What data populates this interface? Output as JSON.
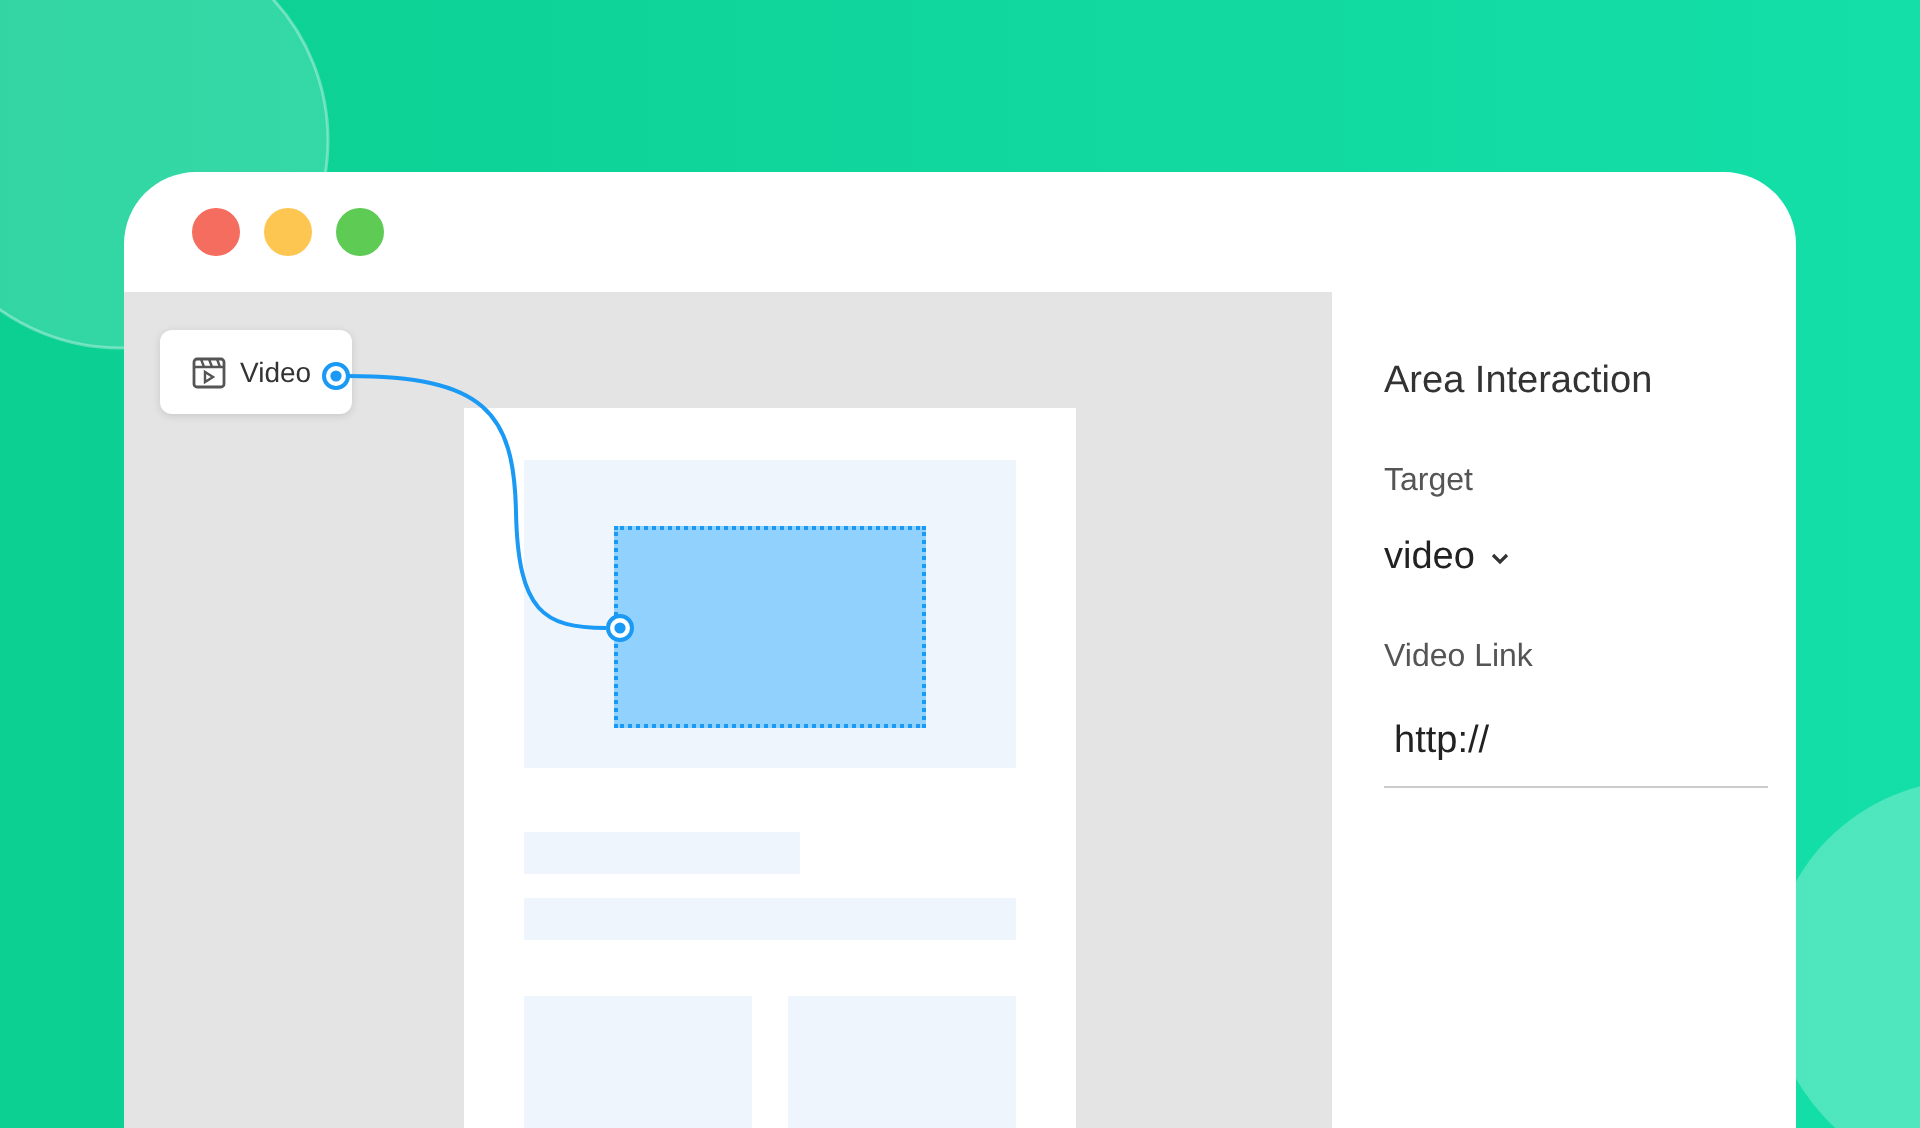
{
  "window": {
    "controls": [
      {
        "color": "#f56d5e"
      },
      {
        "color": "#fdc651"
      },
      {
        "color": "#5ecb54"
      }
    ]
  },
  "canvas": {
    "node": {
      "label": "Video"
    }
  },
  "panel": {
    "title": "Area Interaction",
    "target_label": "Target",
    "target_value": "video",
    "link_label": "Video Link",
    "link_value": "http://"
  }
}
